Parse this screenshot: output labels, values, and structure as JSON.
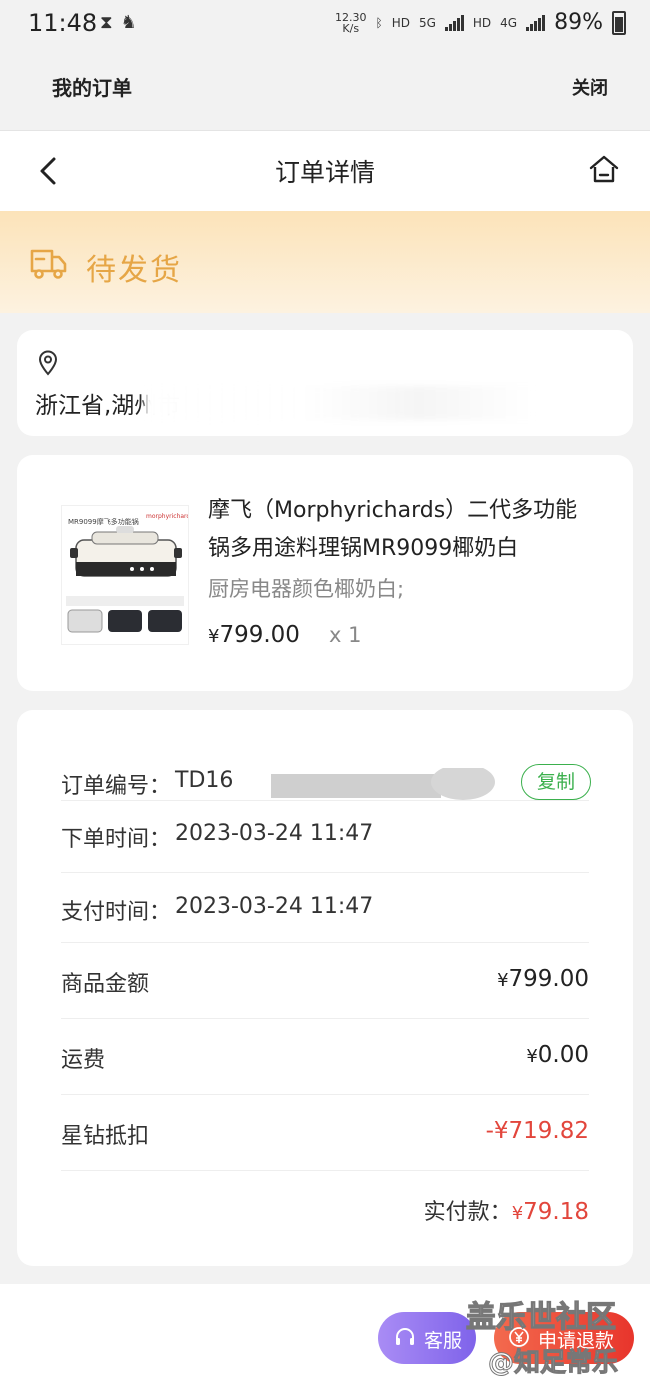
{
  "status_bar": {
    "time": "11:48",
    "net_speed_value": "12.30",
    "net_speed_unit": "K/s",
    "hd1": "HD",
    "net1": "5G",
    "hd2": "HD",
    "net2": "4G",
    "battery": "89%"
  },
  "mini_program": {
    "title": "我的订单",
    "close_label": "关闭"
  },
  "nav": {
    "title": "订单详情"
  },
  "order_status": {
    "label": "待发货"
  },
  "address": {
    "text": "浙江省,湖州市"
  },
  "product": {
    "title": "摩飞（Morphyrichards）二代多功能锅多用途料理锅MR9099椰奶白",
    "spec": "厨房电器颜色椰奶白;",
    "currency": "¥",
    "price": "799.00",
    "quantity": "x 1",
    "image_caption": "MR9099摩飞多功能锅",
    "image_brand": "morphyrichards"
  },
  "order_info": {
    "order_no_label": "订单编号：",
    "order_no_value": "TD16",
    "copy_label": "复制",
    "order_time_label": "下单时间：",
    "order_time_value": "2023-03-24 11:47",
    "pay_time_label": "支付时间：",
    "pay_time_value": "2023-03-24 11:47",
    "goods_amount_label": "商品金额",
    "goods_amount_value": "799.00",
    "shipping_label": "运费",
    "shipping_value": "0.00",
    "discount_label": "星钻抵扣",
    "discount_value": "-¥719.82",
    "paid_label": "实付款：",
    "paid_value": "79.18",
    "currency": "¥"
  },
  "bottom": {
    "service_label": "客服",
    "refund_label": "申请退款"
  },
  "watermark": {
    "line1": "盖乐世社区",
    "line2": "@知足常乐"
  },
  "colors": {
    "accent_orange": "#e6a646",
    "price_red": "#e2463c",
    "copy_green": "#3bb04d",
    "service_purple": "#8a6ff0"
  }
}
